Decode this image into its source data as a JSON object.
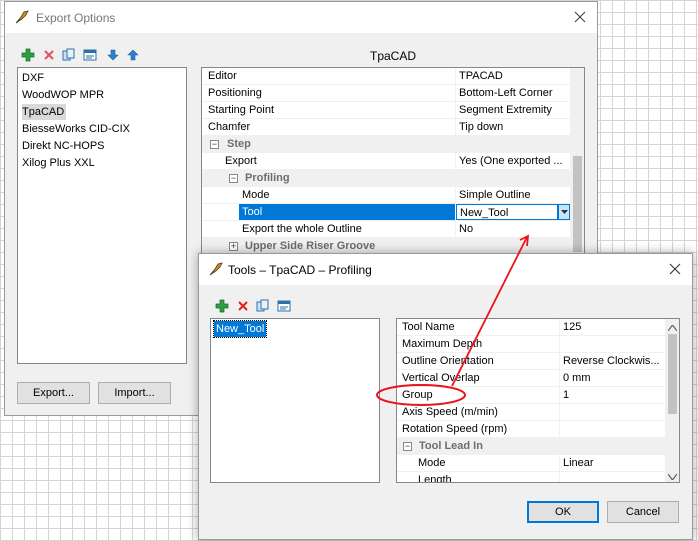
{
  "export_window": {
    "title": "Export Options",
    "formats": [
      "DXF",
      "WoodWOP MPR",
      "TpaCAD",
      "BiesseWorks CID-CIX",
      "Direkt NC-HOPS",
      "Xilog Plus XXL"
    ],
    "selected_format": "TpaCAD",
    "panel_title": "TpaCAD",
    "export_button": "Export...",
    "import_button": "Import...",
    "properties": [
      {
        "name": "Editor",
        "value": "TPACAD"
      },
      {
        "name": "Positioning",
        "value": "Bottom-Left Corner"
      },
      {
        "name": "Starting Point",
        "value": "Segment Extremity"
      },
      {
        "name": "Chamfer",
        "value": "Tip down"
      },
      {
        "name": "Step",
        "value": ""
      },
      {
        "name": "Export",
        "value": "Yes (One exported ..."
      },
      {
        "name": "Profiling",
        "value": ""
      },
      {
        "name": "Mode",
        "value": "Simple Outline"
      },
      {
        "name": "Tool",
        "value": "New_Tool"
      },
      {
        "name": "Export the whole Outline",
        "value": "No"
      },
      {
        "name": "Upper Side Riser Groove",
        "value": ""
      }
    ]
  },
  "tools_window": {
    "title": "Tools – TpaCAD – Profiling",
    "tools": [
      "New_Tool"
    ],
    "ok_button": "OK",
    "cancel_button": "Cancel",
    "properties": [
      {
        "name": "Tool Name",
        "value": "125"
      },
      {
        "name": "Maximum Depth",
        "value": ""
      },
      {
        "name": "Outline Orientation",
        "value": "Reverse Clockwis..."
      },
      {
        "name": "Vertical Overlap",
        "value": "0 mm"
      },
      {
        "name": "Group",
        "value": "1"
      },
      {
        "name": "Axis Speed (m/min)",
        "value": ""
      },
      {
        "name": "Rotation Speed (rpm)",
        "value": ""
      },
      {
        "name": "Tool Lead In",
        "value": ""
      },
      {
        "name": "Mode",
        "value": "Linear"
      },
      {
        "name": "Length",
        "value": ""
      }
    ]
  },
  "annotation_color": "#e8131b"
}
